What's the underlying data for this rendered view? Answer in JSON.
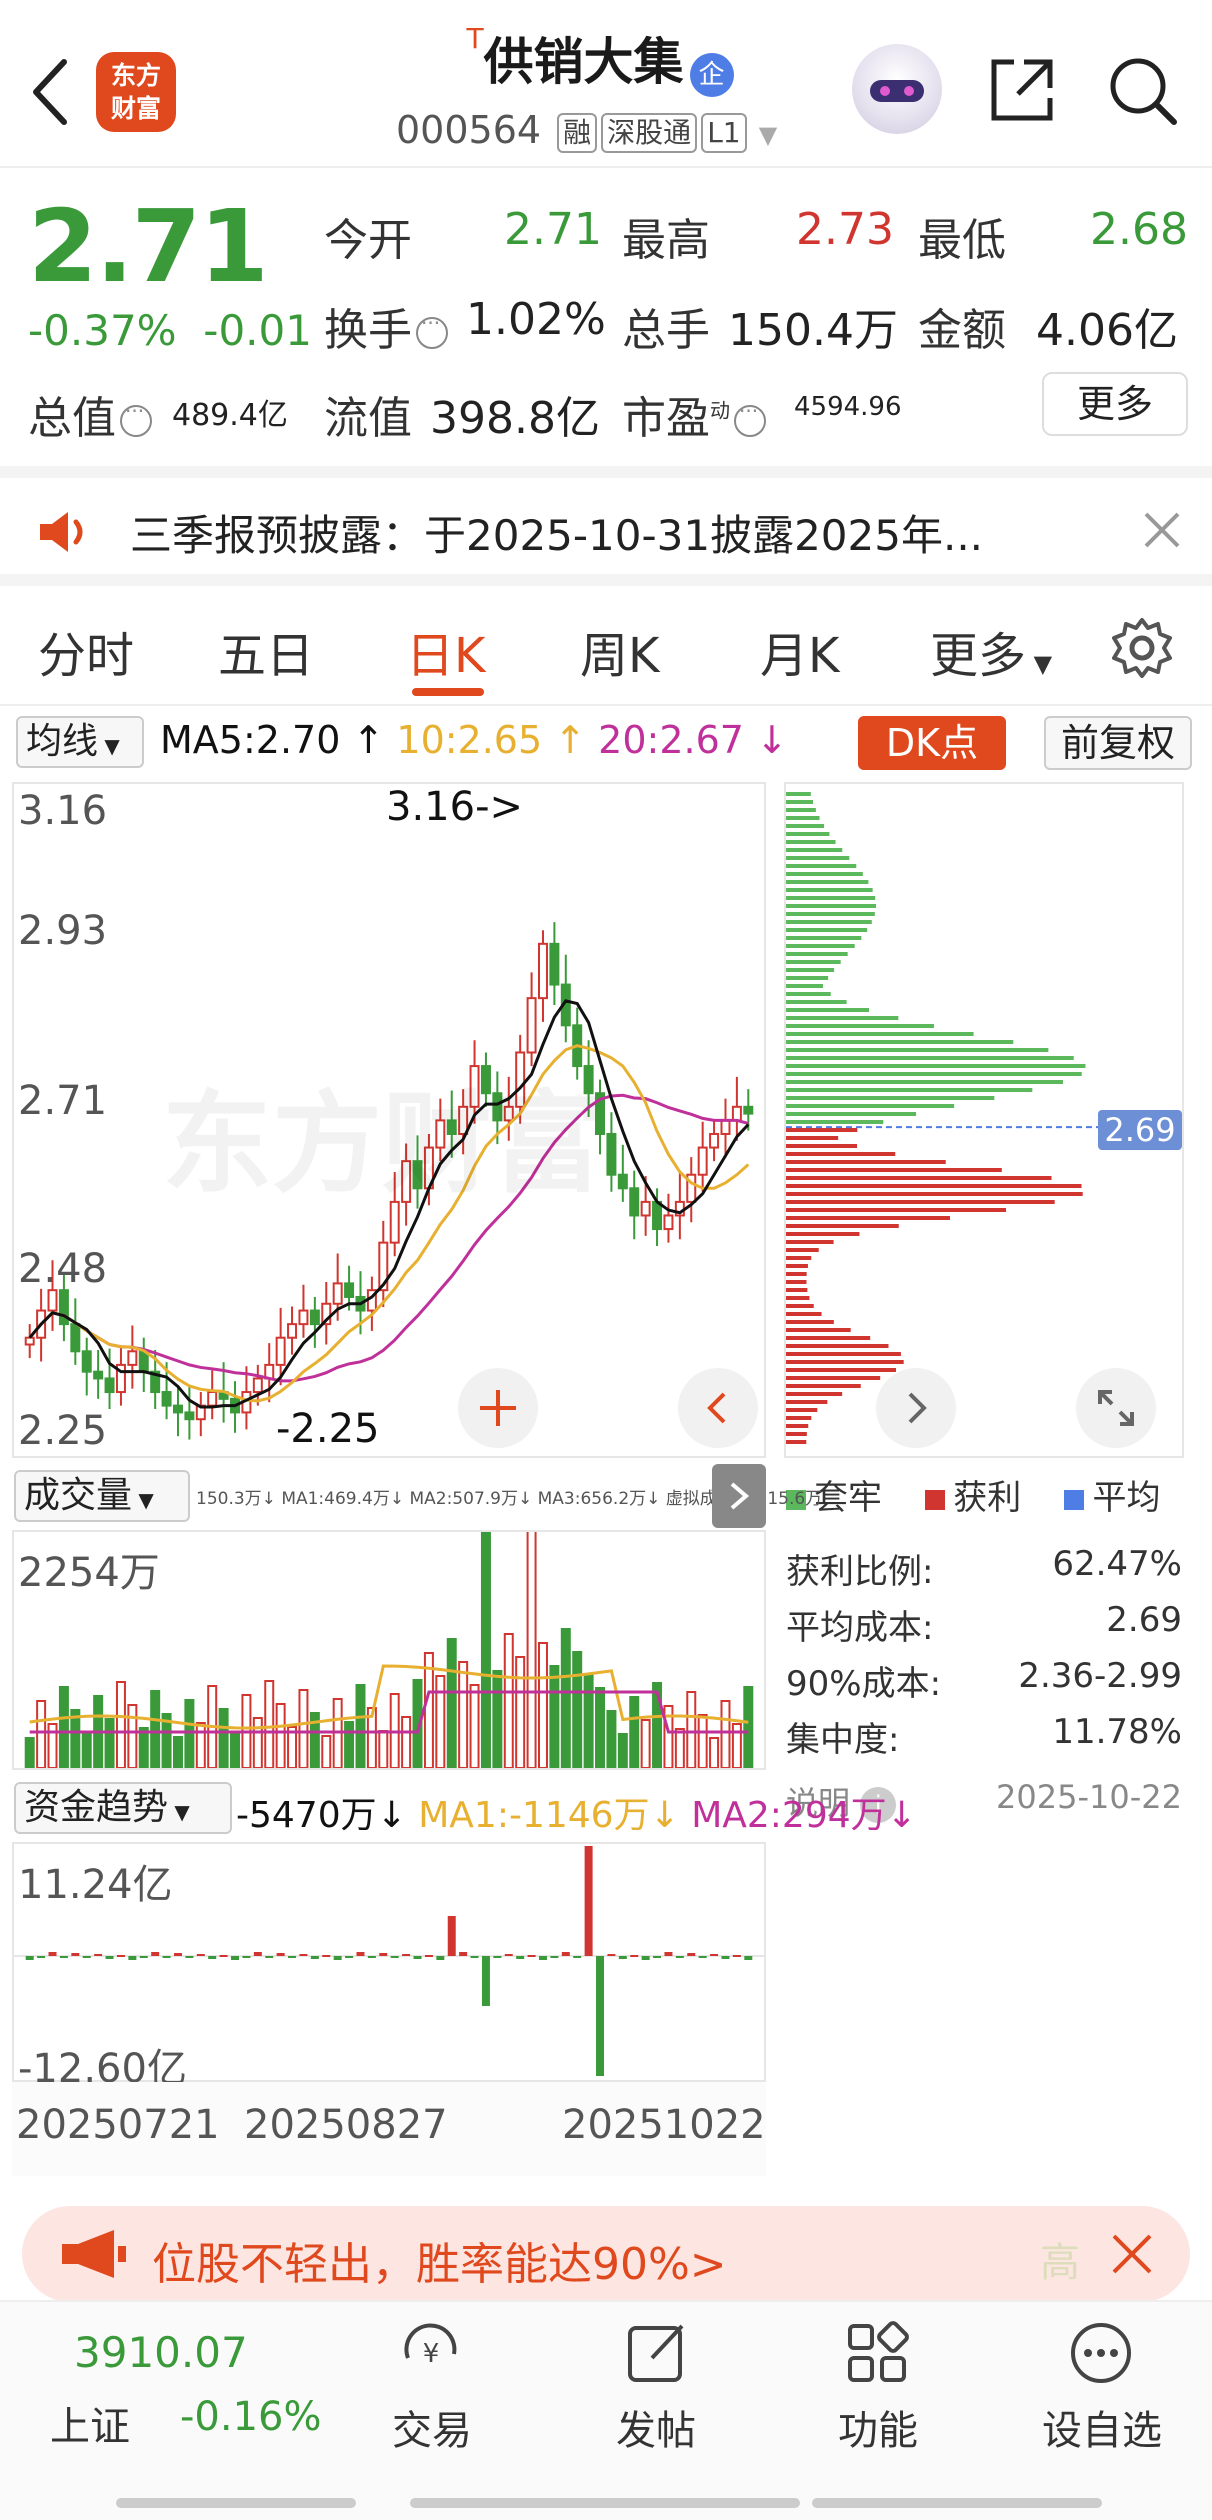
{
  "header": {
    "logo_line1": "东方",
    "logo_line2": "财富",
    "title_prefix": "T",
    "title": "供销大集",
    "badge": "企",
    "code": "000564",
    "tags": [
      "融",
      "深股通",
      "L1"
    ]
  },
  "quote": {
    "price": "2.71",
    "change_pct": "-0.37%",
    "change_abs": "-0.01",
    "fields": {
      "open_label": "今开",
      "open": "2.71",
      "high_label": "最高",
      "high": "2.73",
      "low_label": "最低",
      "low": "2.68",
      "turnover_label": "换手",
      "turnover": "1.02%",
      "volume_label": "总手",
      "volume": "150.4万",
      "amount_label": "金额",
      "amount": "4.06亿",
      "mktcap_label": "总值",
      "mktcap": "489.4亿",
      "float_label": "流值",
      "float": "398.8亿",
      "pe_label": "市盈",
      "pe_sup": "动",
      "pe": "4594.96"
    },
    "more_label": "更多"
  },
  "notice": {
    "text": "三季报预披露：于2025-10-31披露2025年..."
  },
  "tabs": [
    "分时",
    "五日",
    "日K",
    "周K",
    "月K",
    "更多"
  ],
  "active_tab": "日K",
  "ma_bar": {
    "selector": "均线",
    "ma5": "MA5:2.70 ↑",
    "ma10": "10:2.65 ↑",
    "ma20": "20:2.67 ↓",
    "dk_label": "DK点",
    "adjust_label": "前复权"
  },
  "kline": {
    "y_labels": [
      "3.16",
      "2.93",
      "2.71",
      "2.48",
      "2.25"
    ],
    "high_marker": "3.16->",
    "low_marker": "-2.25",
    "watermark": "东方财富"
  },
  "chips": {
    "price_tag": "2.69",
    "legend": [
      "套牢",
      "获利",
      "平均"
    ],
    "stats": [
      {
        "label": "获利比例:",
        "value": "62.47%"
      },
      {
        "label": "平均成本:",
        "value": "2.69"
      },
      {
        "label": "90%成本:",
        "value": "2.36-2.99"
      },
      {
        "label": "集中度:",
        "value": "11.78%"
      }
    ],
    "note_label": "说明",
    "date": "2025-10-22"
  },
  "volume": {
    "selector": "成交量",
    "line": "150.3万↓  MA1:469.4万↓  MA2:507.9万↓  MA3:656.2万↓  虚拟成交量:515.6万",
    "max_label": "2254万"
  },
  "fund": {
    "selector": "资金趋势",
    "value": "-5470万↓",
    "ma1": "MA1:-1146万↓",
    "ma2": "MA2:294万↓",
    "max_label": "11.24亿",
    "min_label": "-12.60亿"
  },
  "dates": [
    "20250721",
    "20250827",
    "20251022"
  ],
  "ad": {
    "text": "位股不轻出，胜率能达90%>",
    "end_text": "高"
  },
  "bottom_nav": {
    "index_value": "3910.07",
    "index_name": "上证",
    "index_change": "-0.16%",
    "items": [
      "交易",
      "发帖",
      "功能",
      "设自选"
    ]
  },
  "colors": {
    "up": "#d0352f",
    "down": "#3a9a3a",
    "accent": "#e0481e",
    "ma5": "#111111",
    "ma10": "#e8b030",
    "ma20": "#c0309a"
  },
  "chart_data": {
    "type": "candlestick",
    "ylim": [
      2.25,
      3.16
    ],
    "x_labels": [
      "20250721",
      "20250827",
      "20251022"
    ],
    "close_series": [
      2.38,
      2.42,
      2.45,
      2.4,
      2.36,
      2.33,
      2.32,
      2.3,
      2.34,
      2.36,
      2.33,
      2.3,
      2.28,
      2.27,
      2.26,
      2.28,
      2.3,
      2.29,
      2.27,
      2.3,
      2.32,
      2.34,
      2.38,
      2.4,
      2.42,
      2.4,
      2.43,
      2.46,
      2.44,
      2.42,
      2.45,
      2.52,
      2.58,
      2.64,
      2.6,
      2.66,
      2.7,
      2.68,
      2.72,
      2.78,
      2.74,
      2.7,
      2.72,
      2.8,
      2.88,
      2.96,
      2.9,
      2.84,
      2.78,
      2.74,
      2.68,
      2.62,
      2.6,
      2.56,
      2.58,
      2.54,
      2.56,
      2.58,
      2.62,
      2.66,
      2.68,
      2.7,
      2.72,
      2.71
    ]
  }
}
